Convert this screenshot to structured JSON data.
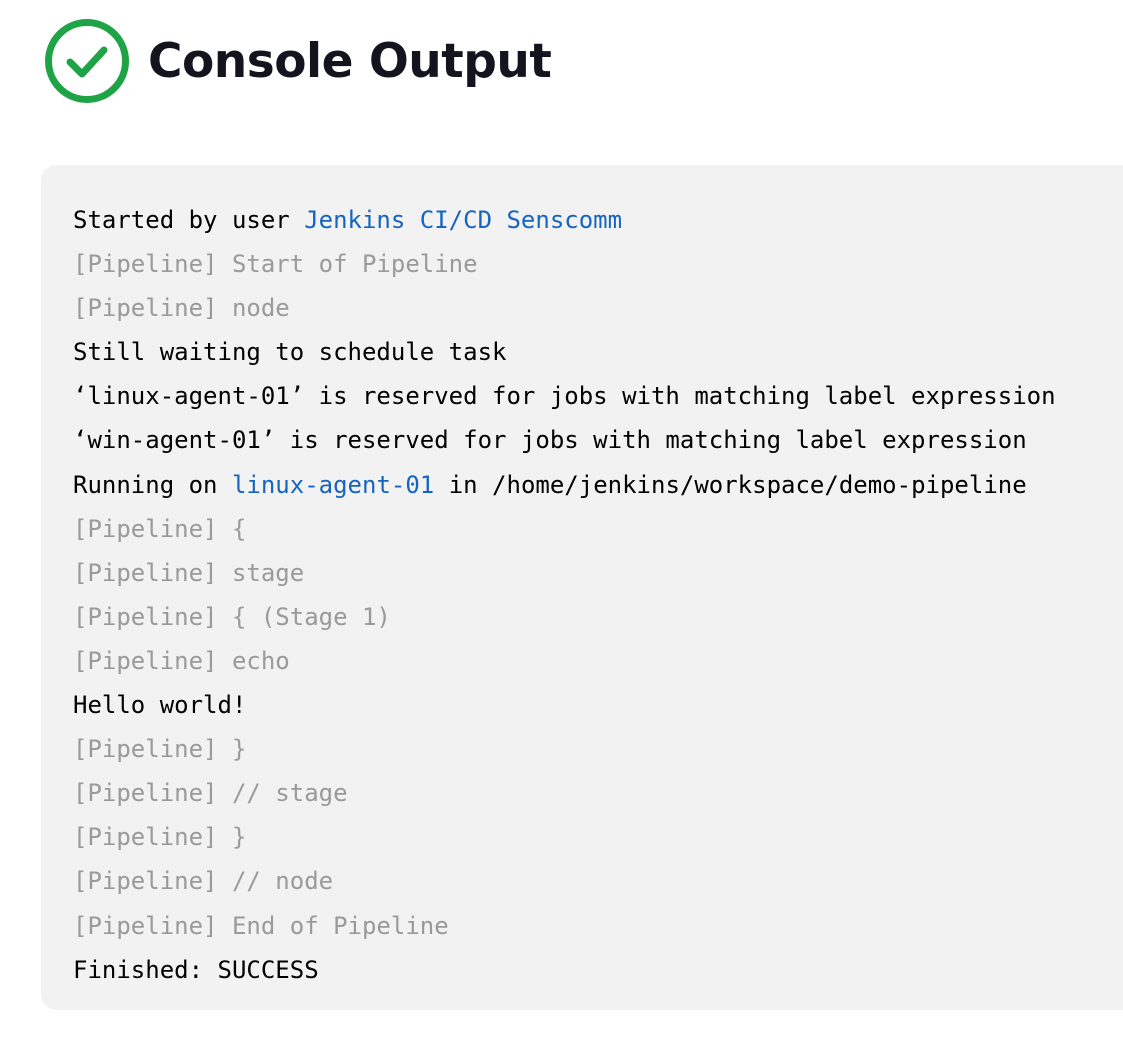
{
  "header": {
    "title": "Console Output",
    "status_icon": "success-check-icon",
    "status_color": "#1ea446"
  },
  "colors": {
    "console_background": "#f2f2f2",
    "pipeline_text": "#9a9a9a",
    "default_text": "#000000",
    "link": "#1565c0"
  },
  "console": {
    "lines": [
      {
        "type": "info",
        "parts": [
          {
            "text": "Started by user "
          },
          {
            "text": "Jenkins CI/CD Senscomm",
            "link": true
          }
        ]
      },
      {
        "type": "pipeline",
        "parts": [
          {
            "text": "[Pipeline] Start of Pipeline"
          }
        ]
      },
      {
        "type": "pipeline",
        "parts": [
          {
            "text": "[Pipeline] node"
          }
        ]
      },
      {
        "type": "info",
        "parts": [
          {
            "text": "Still waiting to schedule task"
          }
        ]
      },
      {
        "type": "info",
        "parts": [
          {
            "text": "‘linux-agent-01’ is reserved for jobs with matching label expression"
          }
        ]
      },
      {
        "type": "info",
        "parts": [
          {
            "text": "‘win-agent-01’ is reserved for jobs with matching label expression"
          }
        ]
      },
      {
        "type": "info",
        "parts": [
          {
            "text": "Running on "
          },
          {
            "text": "linux-agent-01",
            "link": true
          },
          {
            "text": " in /home/jenkins/workspace/demo-pipeline"
          }
        ]
      },
      {
        "type": "pipeline",
        "parts": [
          {
            "text": "[Pipeline] {"
          }
        ]
      },
      {
        "type": "pipeline",
        "parts": [
          {
            "text": "[Pipeline] stage"
          }
        ]
      },
      {
        "type": "pipeline",
        "parts": [
          {
            "text": "[Pipeline] { (Stage 1)"
          }
        ]
      },
      {
        "type": "pipeline",
        "parts": [
          {
            "text": "[Pipeline] echo"
          }
        ]
      },
      {
        "type": "info",
        "parts": [
          {
            "text": "Hello world!"
          }
        ]
      },
      {
        "type": "pipeline",
        "parts": [
          {
            "text": "[Pipeline] }"
          }
        ]
      },
      {
        "type": "pipeline",
        "parts": [
          {
            "text": "[Pipeline] // stage"
          }
        ]
      },
      {
        "type": "pipeline",
        "parts": [
          {
            "text": "[Pipeline] }"
          }
        ]
      },
      {
        "type": "pipeline",
        "parts": [
          {
            "text": "[Pipeline] // node"
          }
        ]
      },
      {
        "type": "pipeline",
        "parts": [
          {
            "text": "[Pipeline] End of Pipeline"
          }
        ]
      },
      {
        "type": "info",
        "parts": [
          {
            "text": "Finished: SUCCESS"
          }
        ]
      }
    ]
  }
}
